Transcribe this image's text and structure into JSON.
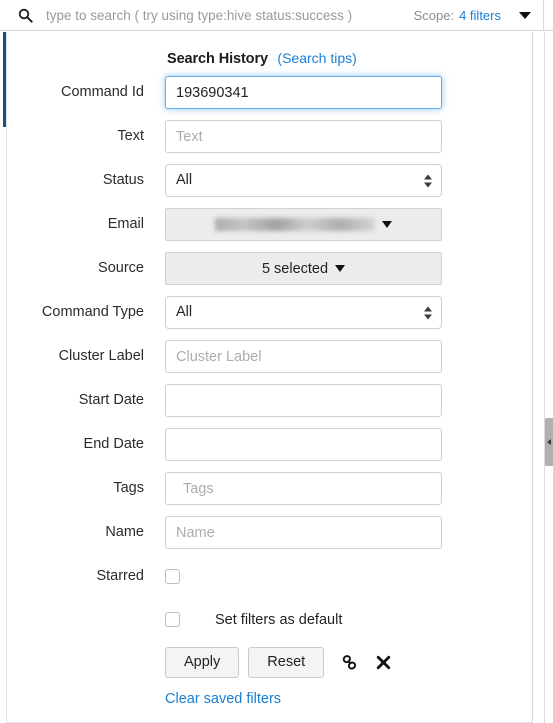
{
  "search_bar": {
    "icon": "search-icon",
    "value": "",
    "placeholder": "type to search ( try using type:hive status:success )",
    "scope_label": "Scope:",
    "scope_value": "4 filters",
    "caret_icon": "chevron-down-icon"
  },
  "panel": {
    "title": "Search History",
    "tips_link": "(Search tips)"
  },
  "fields": {
    "command_id": {
      "label": "Command Id",
      "value": "193690341",
      "placeholder": "Command Id",
      "focused": true
    },
    "text": {
      "label": "Text",
      "value": "",
      "placeholder": "Text"
    },
    "status": {
      "label": "Status",
      "value": "All"
    },
    "email": {
      "label": "Email",
      "value": "",
      "redacted": true,
      "caret_icon": "chevron-down-icon"
    },
    "source": {
      "label": "Source",
      "value": "5 selected",
      "caret_icon": "chevron-down-icon"
    },
    "command_type": {
      "label": "Command Type",
      "value": "All"
    },
    "cluster_label": {
      "label": "Cluster Label",
      "value": "",
      "placeholder": "Cluster Label"
    },
    "start_date": {
      "label": "Start Date",
      "value": "",
      "placeholder": ""
    },
    "end_date": {
      "label": "End Date",
      "value": "",
      "placeholder": ""
    },
    "tags": {
      "label": "Tags",
      "value": "",
      "placeholder": "Tags"
    },
    "name": {
      "label": "Name",
      "value": "",
      "placeholder": "Name"
    },
    "starred": {
      "label": "Starred",
      "checked": false
    }
  },
  "actions": {
    "set_default_label": "Set filters as default",
    "set_default_checked": false,
    "apply_label": "Apply",
    "reset_label": "Reset",
    "link_icon": "link-icon",
    "close_icon": "close-icon",
    "clear_link": "Clear saved filters"
  },
  "chrome": {
    "collapse_handle_icon": "chevron-right-icon"
  },
  "colors": {
    "link_blue": "#1a7fd4",
    "focus_blue": "#66afe9",
    "nav_accent": "#1c4f7c",
    "field_gray": "#ececec"
  }
}
